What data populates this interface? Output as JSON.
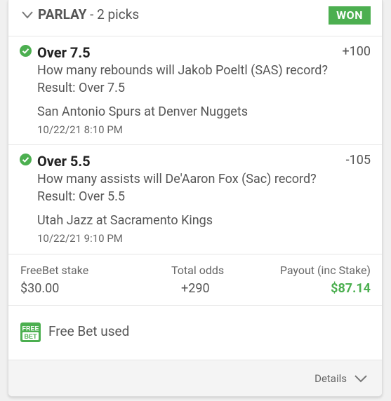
{
  "header": {
    "title_bold": "PARLAY",
    "title_rest": " - 2 picks",
    "status_badge": "WON"
  },
  "picks": [
    {
      "selection": "Over 7.5",
      "odds": "+100",
      "question": "How many rebounds will Jakob Poeltl (SAS) record?",
      "result": "Result: Over 7.5",
      "event": "San Antonio Spurs at Denver Nuggets",
      "datetime": "10/22/21 8:10 PM"
    },
    {
      "selection": "Over 5.5",
      "odds": "-105",
      "question": "How many assists will De'Aaron Fox (Sac) record?",
      "result": "Result: Over 5.5",
      "event": "Utah Jazz at Sacramento Kings",
      "datetime": "10/22/21 9:10 PM"
    }
  ],
  "summary": {
    "stake_label": "FreeBet stake",
    "stake_value": "$30.00",
    "odds_label": "Total odds",
    "odds_value": "+290",
    "payout_label": "Payout (inc Stake)",
    "payout_value": "$87.14"
  },
  "freebet": {
    "icon_text_top": "FREE",
    "icon_text_bottom": "BET",
    "label": "Free Bet used"
  },
  "footer": {
    "details_label": "Details"
  },
  "colors": {
    "accent_green": "#4caf50",
    "text_gray": "#555555"
  }
}
